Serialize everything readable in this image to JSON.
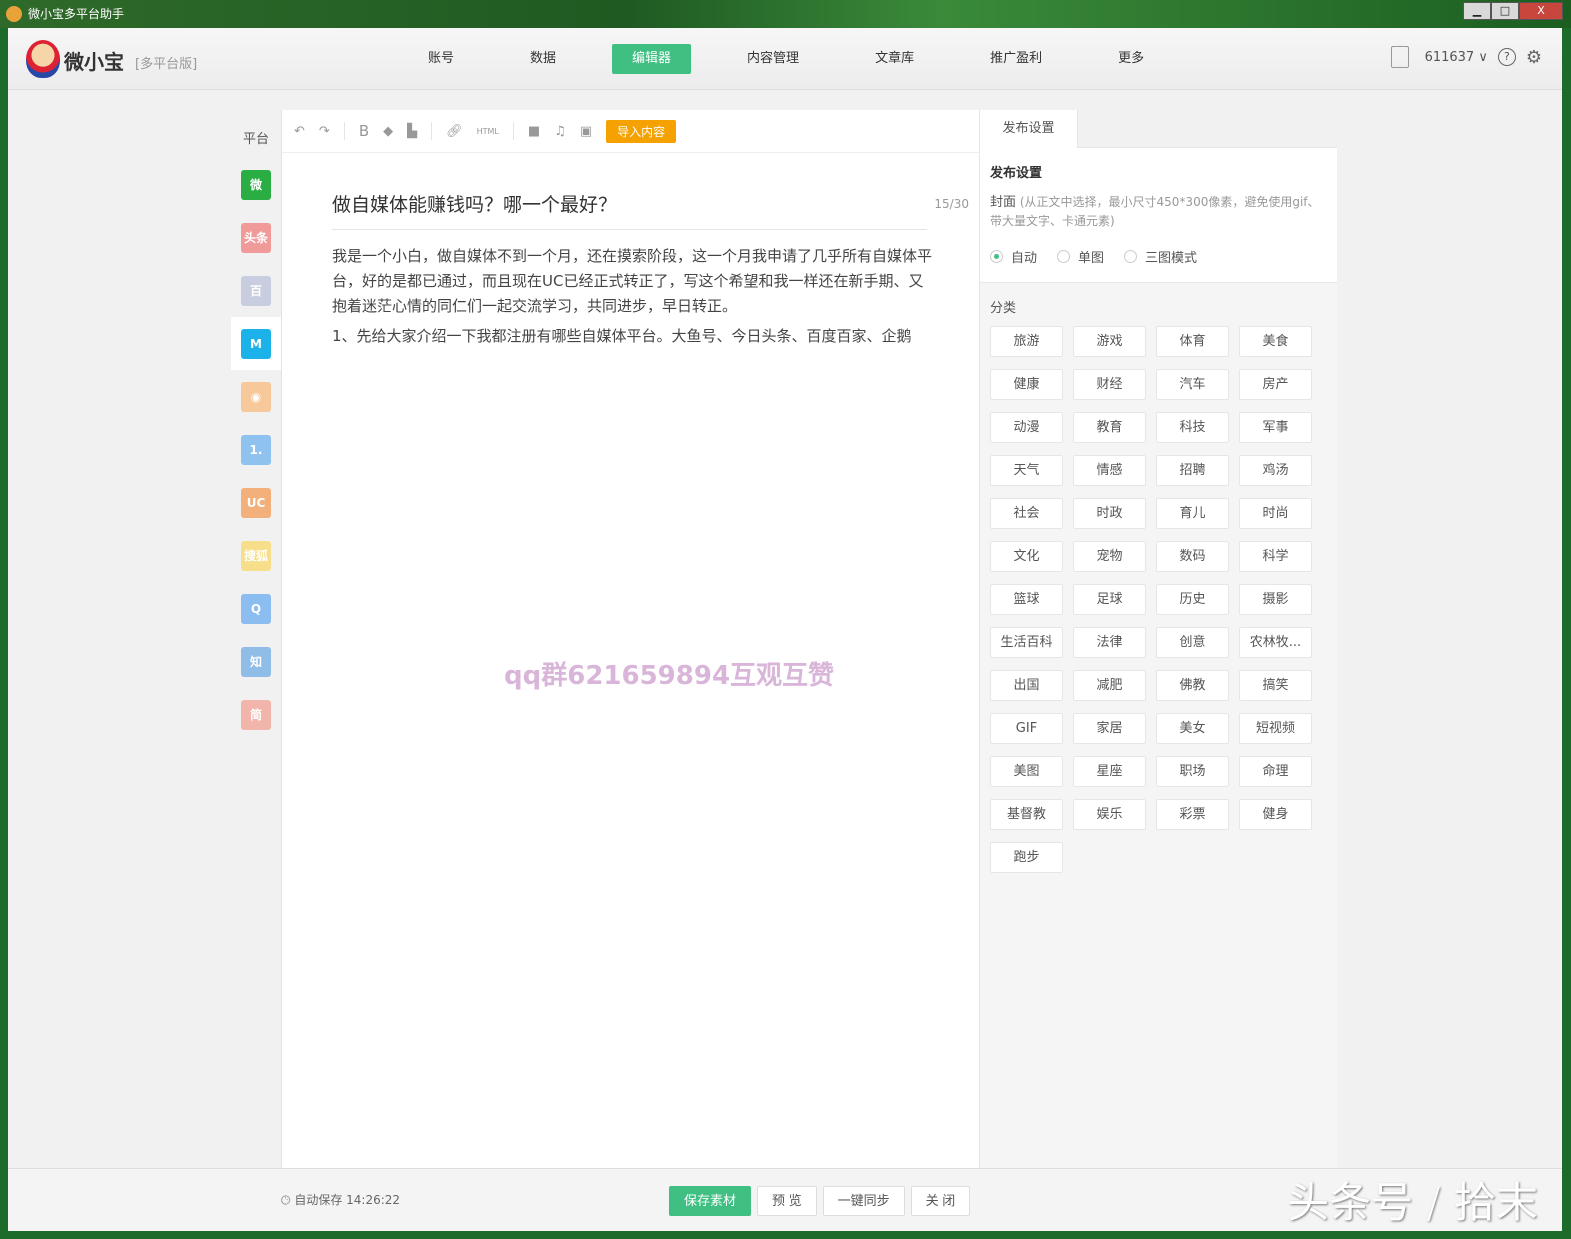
{
  "window": {
    "title": "微小宝多平台助手",
    "controls": [
      "▁",
      "□",
      "X"
    ]
  },
  "header": {
    "brand": "微小宝",
    "edition": "[多平台版]",
    "nav": [
      {
        "label": "账号"
      },
      {
        "label": "数据"
      },
      {
        "label": "编辑器",
        "active": true
      },
      {
        "label": "内容管理"
      },
      {
        "label": "文章库"
      },
      {
        "label": "推广盈利"
      },
      {
        "label": "更多"
      }
    ],
    "account": "611637 ∨",
    "help": "?",
    "settings": "⚙"
  },
  "platforms": {
    "label": "平台",
    "items": [
      {
        "icon": "wechat-icon",
        "glyph": "微",
        "color": "#2aae44"
      },
      {
        "icon": "toutiao-icon",
        "glyph": "头条",
        "color": "#f19a9a"
      },
      {
        "icon": "baijia-icon",
        "glyph": "百",
        "color": "#c9cde0"
      },
      {
        "icon": "dayu-icon",
        "glyph": "M",
        "color": "#1ab2e8",
        "active": true
      },
      {
        "icon": "weibo-icon",
        "glyph": "◉",
        "color": "#f7c89a"
      },
      {
        "icon": "yidian-icon",
        "glyph": "1.",
        "color": "#8fc2ee"
      },
      {
        "icon": "uc-icon",
        "glyph": "UC",
        "color": "#f3b07a"
      },
      {
        "icon": "sohu-icon",
        "glyph": "搜狐",
        "color": "#f6de8a"
      },
      {
        "icon": "qq-icon",
        "glyph": "Q",
        "color": "#8cbdf0"
      },
      {
        "icon": "zhihu-icon",
        "glyph": "知",
        "color": "#8fbde8"
      },
      {
        "icon": "jianshu-icon",
        "glyph": "简",
        "color": "#f2b5ac"
      }
    ]
  },
  "toolbar": {
    "html": "HTML",
    "import": "导入内容"
  },
  "editor": {
    "title": "做自媒体能赚钱吗？哪一个最好？",
    "count": "15/30",
    "paragraphs": [
      "我是一个小白，做自媒体不到一个月，还在摸索阶段，这一个月我申请了几乎所有自媒体平台，好的是都已通过，而且现在UC已经正式转正了，写这个希望和我一样还在新手期、又抱着迷茫心情的同仁们一起交流学习，共同进步，早日转正。",
      "1、先给大家介绍一下我都注册有哪些自媒体平台。大鱼号、今日头条、百度百家、企鹅"
    ],
    "watermark": "qq群621659894互观互赞"
  },
  "settings": {
    "tab": "发布设置",
    "heading": "发布设置",
    "cover_label": "封面",
    "cover_hint": "(从正文中选择，最小尺寸450*300像素，避免使用gif、带大量文字、卡通元素)",
    "cover_modes": [
      {
        "label": "自动",
        "selected": true
      },
      {
        "label": "单图"
      },
      {
        "label": "三图模式"
      }
    ],
    "category_label": "分类",
    "categories": [
      "旅游",
      "游戏",
      "体育",
      "美食",
      "健康",
      "财经",
      "汽车",
      "房产",
      "动漫",
      "教育",
      "科技",
      "军事",
      "天气",
      "情感",
      "招聘",
      "鸡汤",
      "社会",
      "时政",
      "育儿",
      "时尚",
      "文化",
      "宠物",
      "数码",
      "科学",
      "篮球",
      "足球",
      "历史",
      "摄影",
      "生活百科",
      "法律",
      "创意",
      "农林牧...",
      "出国",
      "减肥",
      "佛教",
      "搞笑",
      "GIF",
      "家居",
      "美女",
      "短视频",
      "美图",
      "星座",
      "职场",
      "命理",
      "基督教",
      "娱乐",
      "彩票",
      "健身",
      "跑步"
    ]
  },
  "footer": {
    "autosave": "自动保存 14:26:22",
    "buttons": [
      "保存素材",
      "预 览",
      "一键同步",
      "关 闭"
    ],
    "corner_watermark": "头条号 / 拾末"
  },
  "colors": {
    "accent": "#3fbf82",
    "import": "#f5a100"
  }
}
